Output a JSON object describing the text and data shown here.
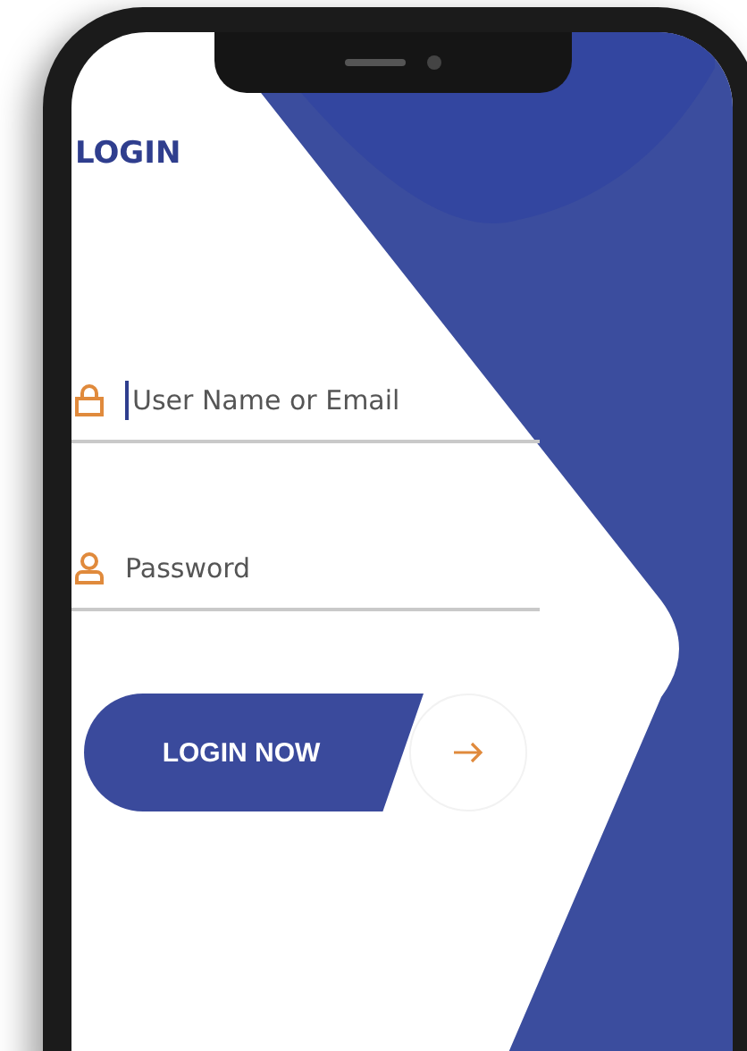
{
  "title": "LOGIN",
  "fields": [
    {
      "kind": "lock",
      "placeholder": "User Name or Email",
      "focused": true
    },
    {
      "kind": "person",
      "placeholder": "Password",
      "focused": false
    }
  ],
  "button": {
    "label": "LOGIN NOW"
  }
}
